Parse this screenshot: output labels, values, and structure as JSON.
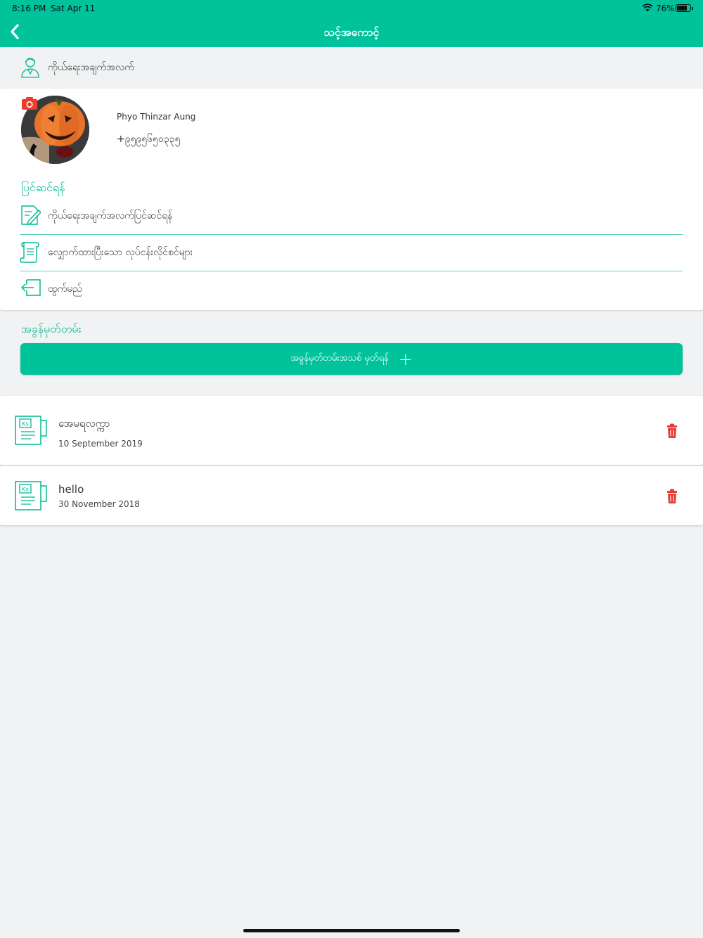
{
  "status_bar": {
    "time": "8:16 PM",
    "date": "Sat Apr 11",
    "battery_percent": "76%",
    "battery_level": 0.76
  },
  "nav": {
    "title": "သင့်အကောင့်",
    "back_icon": "chevron-left-icon"
  },
  "personal_info": {
    "label": "ကိုယ်ရေးအချက်အလက်",
    "icon": "user-outline-icon"
  },
  "profile": {
    "name": "Phyo Thinzar Aung",
    "phone": "+၉၅၉၅၆၅၀၃၃၅",
    "camera_icon": "camera-icon"
  },
  "edit": {
    "title": "ပြင်ဆင်ရန်",
    "items": [
      {
        "label": "ကိုယ်ရေးအချက်အလက်ပြင်ဆင်ရန်",
        "icon": "edit-document-icon"
      },
      {
        "label": "လျှောက်ထားပြီးသော လုပ်ငန်းလိုင်စင်များ",
        "icon": "scroll-icon"
      },
      {
        "label": "ထွက်မည်",
        "icon": "logout-icon"
      }
    ]
  },
  "notes": {
    "title": "အခွန်မှတ်တမ်း",
    "add_label": "အခွန်မှတ်တမ်းအသစ် မှတ်ရန်",
    "add_icon": "plus-icon",
    "items": [
      {
        "title": "အေမရလက္ကာ",
        "date": "10 September 2019",
        "icon": "ks-document-icon",
        "delete_icon": "trash-icon"
      },
      {
        "title": "hello",
        "date": "30 November 2018",
        "icon": "ks-document-icon",
        "delete_icon": "trash-icon"
      }
    ]
  },
  "colors": {
    "accent": "#00c39c",
    "accent_text": "#00b891",
    "delete": "#e53935",
    "background": "#f0f2f3"
  }
}
